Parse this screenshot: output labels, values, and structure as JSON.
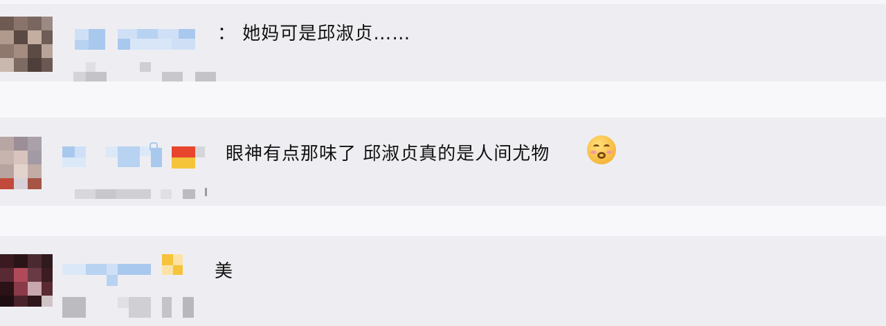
{
  "comments": [
    {
      "text": "： 她妈可是邱淑贞……",
      "emoji": ""
    },
    {
      "text": "眼神有点那味了 邱淑贞真的是人间尤物",
      "emoji": "blushing-face-emoji"
    },
    {
      "text": "美",
      "emoji": ""
    }
  ],
  "colors": {
    "comment_bg": "#eeeef2",
    "username_blur": "#a9c8ee",
    "meta_blur": "#c8c8cc",
    "badge_red": "#e8452f",
    "badge_yellow": "#f5c43a"
  }
}
